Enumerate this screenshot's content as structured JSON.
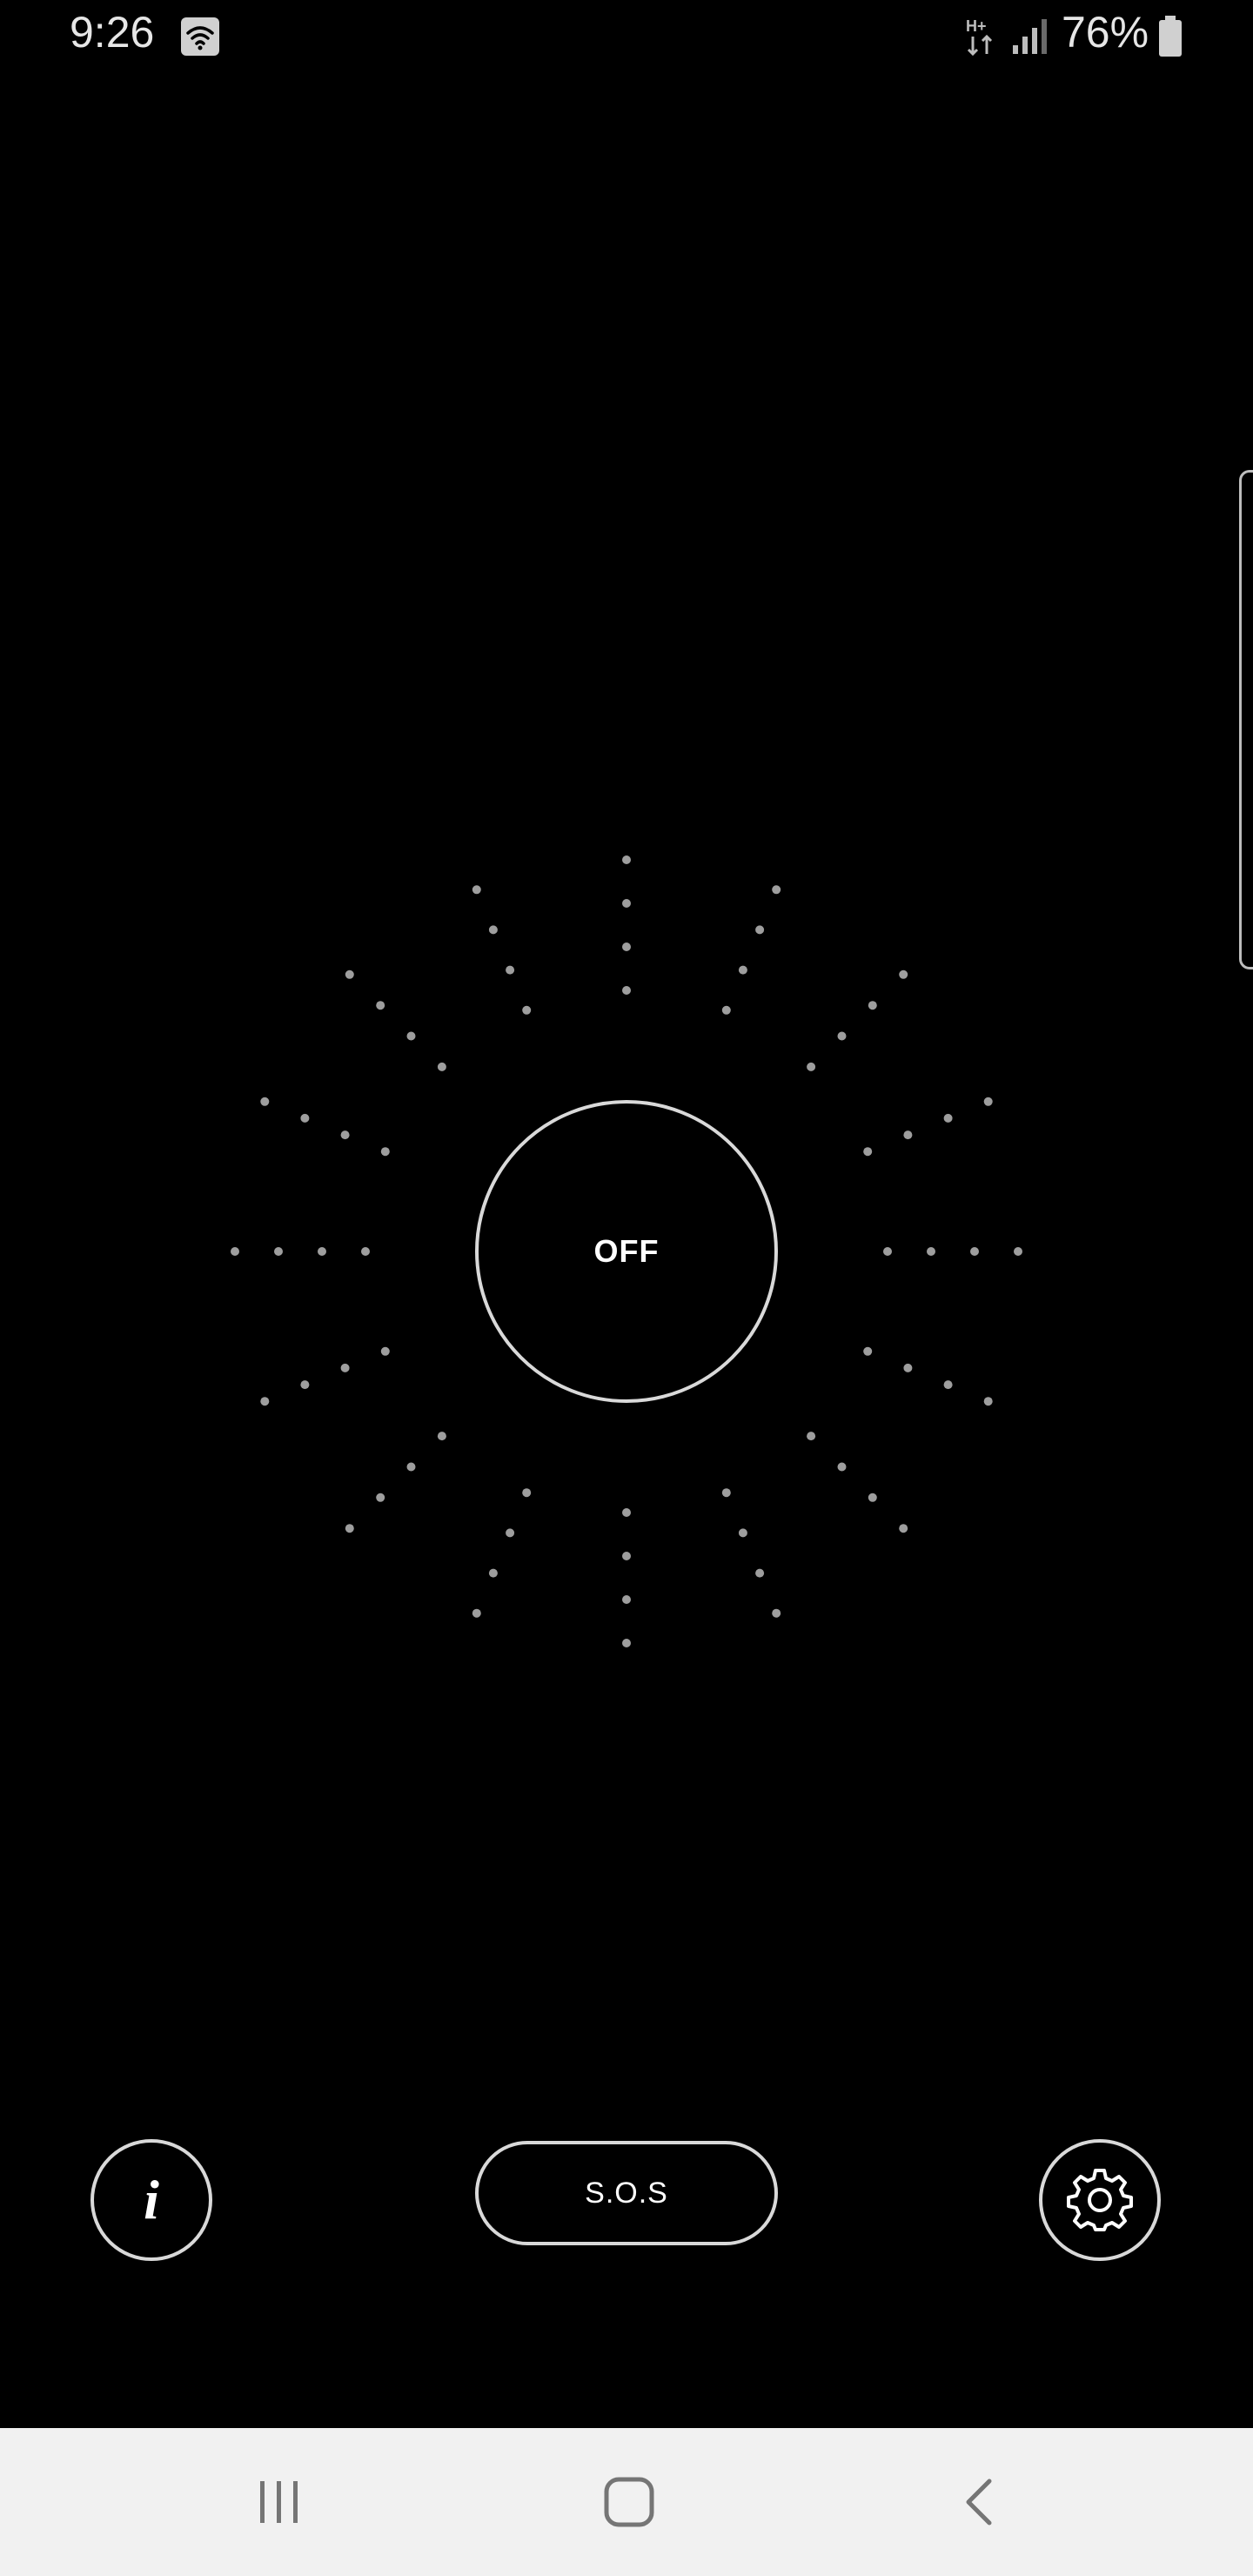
{
  "status_bar": {
    "time": "9:26",
    "network_type": "H+",
    "battery_percent": "76%",
    "icons": [
      "wifi-icon",
      "network-type-icon",
      "signal-icon",
      "battery-icon"
    ]
  },
  "flashlight": {
    "state_label": "OFF"
  },
  "controls": {
    "sos_label": "S.O.S",
    "info_icon": "info-icon",
    "settings_icon": "gear-icon"
  },
  "nav_bar": {
    "icons": [
      "recents-icon",
      "home-icon",
      "back-icon"
    ]
  },
  "colors": {
    "background": "#000000",
    "outline": "#d9d9d9",
    "dots": "#9e9e9e",
    "nav_bar": "#f1f1f1",
    "nav_icons": "#757575"
  }
}
